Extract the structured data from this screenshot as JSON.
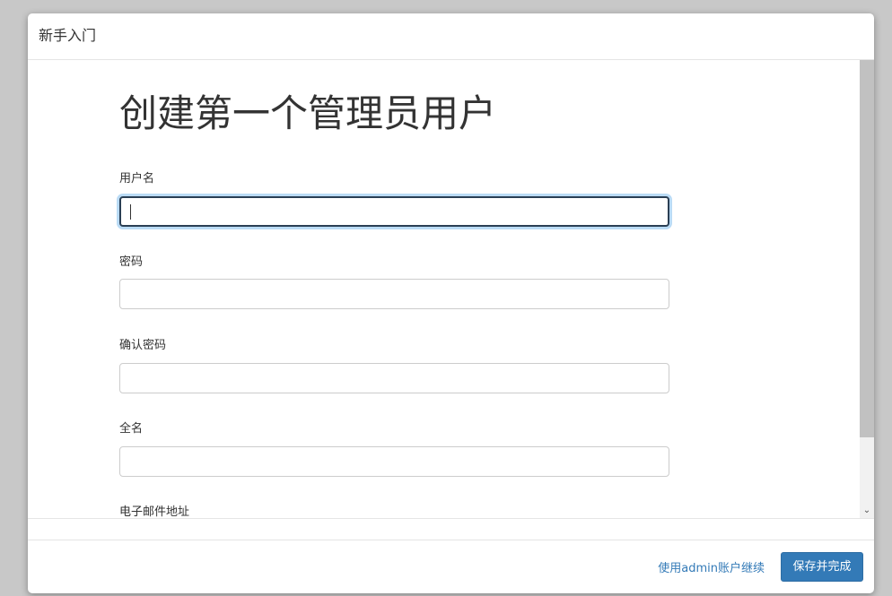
{
  "dialog": {
    "title": "新手入门"
  },
  "form": {
    "heading": "创建第一个管理员用户",
    "fields": [
      {
        "label": "用户名",
        "value": ""
      },
      {
        "label": "密码",
        "value": ""
      },
      {
        "label": "确认密码",
        "value": ""
      },
      {
        "label": "全名",
        "value": ""
      },
      {
        "label": "电子邮件地址",
        "value": ""
      }
    ]
  },
  "footer": {
    "continue_admin_label": "使用admin账户继续",
    "save_finish_label": "保存并完成"
  },
  "colors": {
    "accent": "#337ab7",
    "focus_border": "#2a3f54"
  },
  "icons": {
    "scroll_down": "chevron-down-icon"
  }
}
